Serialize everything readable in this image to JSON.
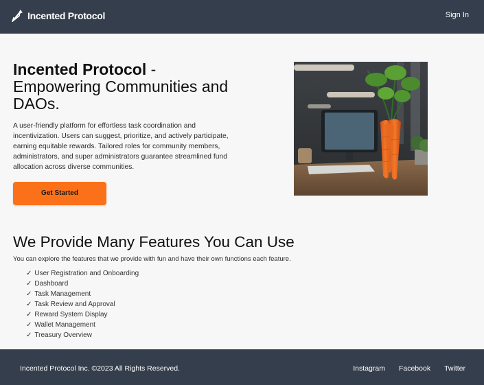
{
  "header": {
    "brand": "Incented Protocol",
    "brand_icon": "carrot-icon",
    "sign_in": "Sign In"
  },
  "hero": {
    "title_strong": "Incented Protocol",
    "title_rest": " - Empowering Communities and DAOs.",
    "description": "A user-friendly platform for effortless task coordination and incentivization. Users can suggest, prioritize, and actively participate, earning equitable rewards. Tailored roles for community members, administrators, and super administrators guarantee streamlined fund allocation across diverse communities.",
    "cta": "Get Started"
  },
  "features": {
    "title": "We Provide Many Features You Can Use",
    "subtitle": "You can explore the features that we provide with fun and have their own functions each feature.",
    "check": "✓",
    "items": [
      "User Registration and Onboarding",
      "Dashboard",
      "Task Management",
      "Task Review and Approval",
      "Reward System Display",
      "Wallet Management",
      "Treasury Overview"
    ]
  },
  "footer": {
    "copyright": "Incented Protocol Inc. ©2023 All Rights Reserved.",
    "links": [
      "Instagram",
      "Facebook",
      "Twitter"
    ]
  },
  "colors": {
    "nav_bg": "#353e4c",
    "accent": "#fb7119",
    "page_bg": "#f7f7f7"
  }
}
